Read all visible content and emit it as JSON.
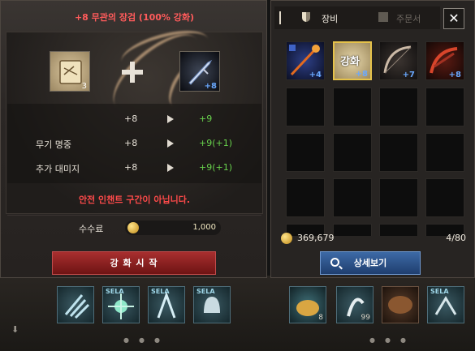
{
  "enchant": {
    "title": "+8 무관의 장검 (100% 강화)",
    "scroll_count": "3",
    "weapon_plus": "+8",
    "stats": [
      {
        "label": "",
        "current": "+8",
        "next": "+9"
      },
      {
        "label": "무기 명중",
        "current": "+8",
        "next": "+9(+1)"
      },
      {
        "label": "추가 대미지",
        "current": "+8",
        "next": "+9(+1)"
      }
    ],
    "warning": "안전 인챈트 구간이 아닙니다.",
    "fee_label": "수수료",
    "fee_value": "1,000",
    "button_label": "강 화 시 작"
  },
  "inventory": {
    "tabs": [
      {
        "label": "장비",
        "active": true
      },
      {
        "label": "주문서",
        "active": false
      }
    ],
    "close_label": "✕",
    "items": [
      {
        "name": "staff",
        "plus": "+4",
        "color": "#3f63c6"
      },
      {
        "name": "enchant-scroll",
        "plus": "+8",
        "label": "강화",
        "selected": true,
        "color": "#c9b98c"
      },
      {
        "name": "bow",
        "plus": "+7",
        "color": "#6b5140"
      },
      {
        "name": "crossbow",
        "plus": "+8",
        "color": "#a33122"
      }
    ],
    "gold": "369,679",
    "slots": "4/80",
    "detail_button": "상세보기"
  },
  "skillbar": {
    "left_skills": [
      {
        "name": "claw-skill",
        "sela": ""
      },
      {
        "name": "burst-skill",
        "sela": "SELA"
      },
      {
        "name": "shot-skill",
        "sela": "SELA"
      },
      {
        "name": "helmet-skill",
        "sela": "SELA"
      }
    ],
    "right_skills": [
      {
        "name": "pouch-skill",
        "sela": "",
        "count": "8"
      },
      {
        "name": "figure-skill",
        "sela": "",
        "count": "99"
      },
      {
        "name": "bowl-skill",
        "sela": "",
        "count": ""
      },
      {
        "name": "beast-skill",
        "sela": "SELA",
        "count": ""
      }
    ]
  },
  "colors": {
    "warning": "#ff4a4a",
    "increase": "#68d24c",
    "plus": "#6aa9ff",
    "enchant_button": "#a82f2f",
    "detail_button": "#3d6aa6"
  }
}
